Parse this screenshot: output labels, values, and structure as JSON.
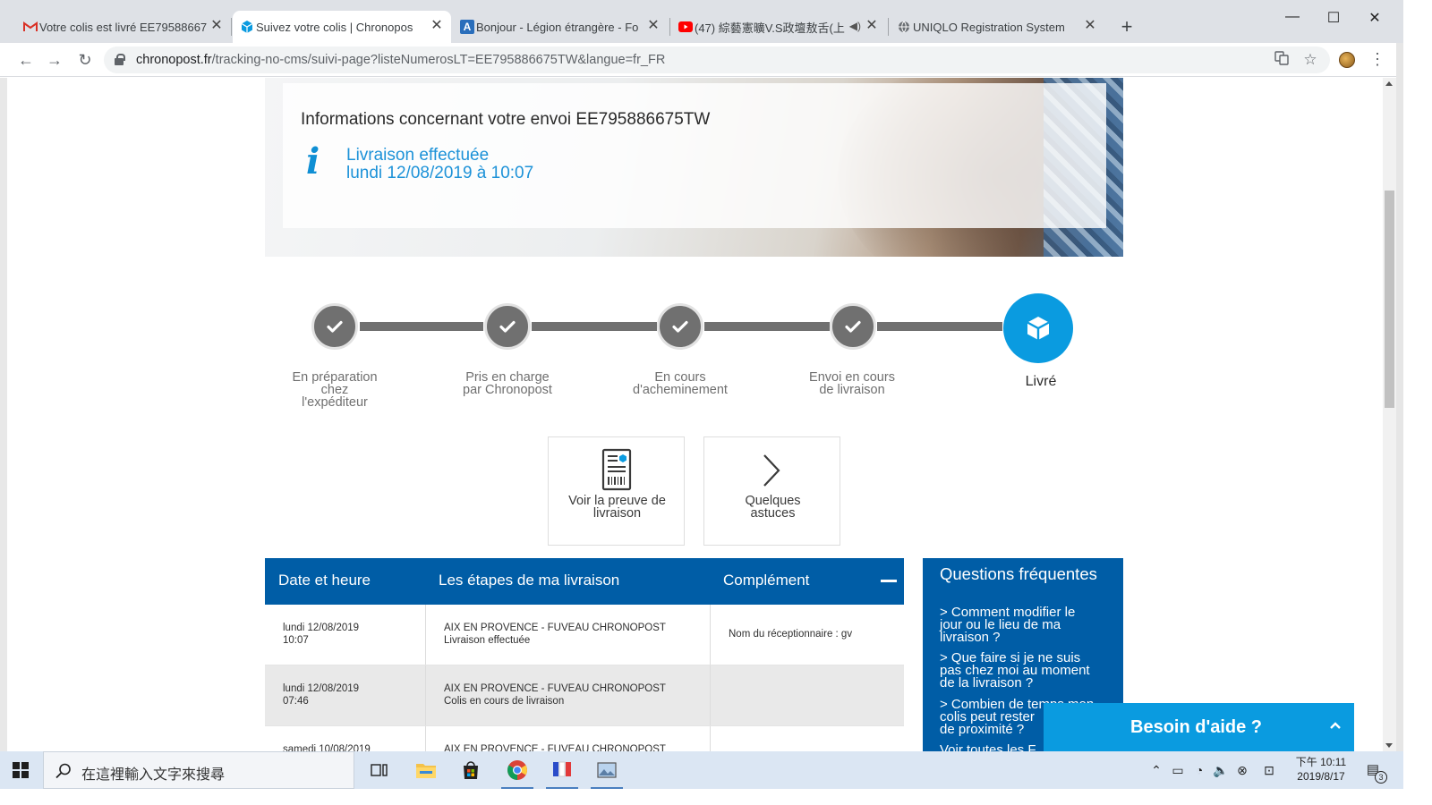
{
  "browser": {
    "tabs": [
      {
        "title": "Votre colis est livré EE79588667",
        "favicon": "gmail-icon",
        "active": false
      },
      {
        "title": "Suivez  votre colis | Chronopos",
        "favicon": "chronopost-box-icon",
        "active": true
      },
      {
        "title": "Bonjour - Légion étrangère - Fo",
        "favicon": "letter-a-icon",
        "active": false
      },
      {
        "title": "(47) 綜藝憲曠V.S政壇敖舌(上",
        "favicon": "youtube-icon",
        "active": false,
        "audio": true
      },
      {
        "title": "UNIQLO Registration System",
        "favicon": "globe-icon",
        "active": false
      }
    ],
    "url_host": "chronopost.fr",
    "url_path": "/tracking-no-cms/suivi-page?listeNumerosLT=EE795886675TW&langue=fr_FR"
  },
  "colors": {
    "brand_blue": "#005da6",
    "accent_blue": "#0a9be0",
    "status_blue": "#1d92d8",
    "step_grey": "#707070"
  },
  "shipment": {
    "heading": "Informations concernant votre envoi EE795886675TW",
    "status_line1": "Livraison effectuée",
    "status_line2": "lundi 12/08/2019 à 10:07"
  },
  "steps": [
    {
      "label_lines": [
        "En préparation",
        "chez",
        "l'expéditeur"
      ],
      "done": true
    },
    {
      "label_lines": [
        "Pris en charge",
        "par Chronopost"
      ],
      "done": true
    },
    {
      "label_lines": [
        "En cours",
        "d'acheminement"
      ],
      "done": true
    },
    {
      "label_lines": [
        "Envoi en cours",
        "de livraison"
      ],
      "done": true
    },
    {
      "label_lines": [
        "Livré"
      ],
      "current": true
    }
  ],
  "actions": [
    {
      "label_lines": [
        "Voir la preuve de",
        "livraison"
      ],
      "icon": "delivery-proof-icon"
    },
    {
      "label_lines": [
        "Quelques",
        "astuces"
      ],
      "icon": "chevron-right-icon"
    }
  ],
  "table": {
    "headers": [
      "Date et heure",
      "Les étapes de ma livraison",
      "Complément"
    ],
    "rows": [
      {
        "date": "lundi 12/08/2019",
        "time": "10:07",
        "place": "AIX EN PROVENCE - FUVEAU CHRONOPOST",
        "event": "Livraison effectuée",
        "complement": "Nom du réceptionnaire : gv"
      },
      {
        "date": "lundi 12/08/2019",
        "time": "07:46",
        "place": "AIX EN PROVENCE - FUVEAU CHRONOPOST",
        "event": "Colis en cours de livraison",
        "complement": ""
      },
      {
        "date": "samedi 10/08/2019",
        "time": "",
        "place": "AIX EN PROVENCE - FUVEAU CHRONOPOST",
        "event": "",
        "complement": ""
      }
    ]
  },
  "faq": {
    "title": "Questions fréquentes",
    "questions": [
      [
        "> Comment modifier le",
        "jour ou le lieu de ma",
        "livraison ?"
      ],
      [
        "> Que faire si je ne suis",
        "pas chez moi au moment",
        "de la livraison ?"
      ],
      [
        "> Combien de temps mon",
        "colis peut rester",
        "de proximité ?"
      ]
    ],
    "see_all": "Voir toutes les F"
  },
  "help": {
    "label": "Besoin d'aide ?"
  },
  "taskbar": {
    "search_placeholder": "在這裡輸入文字來搜尋",
    "apps": [
      "task-view-icon",
      "file-explorer-icon",
      "store-icon",
      "chrome-icon",
      "paint-icon",
      "photos-icon"
    ],
    "clock_line1": "下午 10:11",
    "clock_line2": "2019/8/17",
    "notification_count": "3"
  }
}
